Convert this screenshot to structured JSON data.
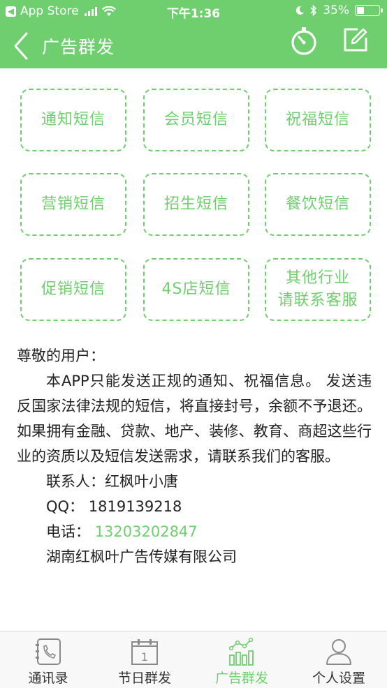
{
  "status_bar": {
    "back_app": "App Store",
    "time": "下午1:36",
    "battery": "35%",
    "battery_level": 0.35
  },
  "nav": {
    "title": "广告群发"
  },
  "categories": [
    {
      "lines": [
        "通知短信"
      ]
    },
    {
      "lines": [
        "会员短信"
      ]
    },
    {
      "lines": [
        "祝福短信"
      ]
    },
    {
      "lines": [
        "营销短信"
      ]
    },
    {
      "lines": [
        "招生短信"
      ]
    },
    {
      "lines": [
        "餐饮短信"
      ]
    },
    {
      "lines": [
        "促销短信"
      ]
    },
    {
      "lines": [
        "4S店短信"
      ]
    },
    {
      "lines": [
        "其他行业",
        "请联系客服"
      ]
    }
  ],
  "notice": {
    "greeting": "尊敬的用户：",
    "body": "本APP只能发送正规的通知、祝福信息。 发送违反国家法律法规的短信，将直接封号，余额不予退还。如果拥有金融、贷款、地产、装修、教育、商超这些行业的资质以及短信发送需求，请联系我们的客服。",
    "contact_label": "联系人：",
    "contact_value": "红枫叶小唐",
    "qq_label": "QQ：",
    "qq_value": "1819139218",
    "phone_label": "电话：",
    "phone_value": "13203202847",
    "company": "湖南红枫叶广告传媒有限公司"
  },
  "tabs": [
    {
      "label": "通讯录",
      "icon": "contacts-icon",
      "active": false
    },
    {
      "label": "节日群发",
      "icon": "calendar-icon",
      "active": false
    },
    {
      "label": "广告群发",
      "icon": "chart-icon",
      "active": true
    },
    {
      "label": "个人设置",
      "icon": "person-icon",
      "active": false
    }
  ],
  "colors": {
    "accent": "#6fcf6f",
    "text": "#222222"
  }
}
